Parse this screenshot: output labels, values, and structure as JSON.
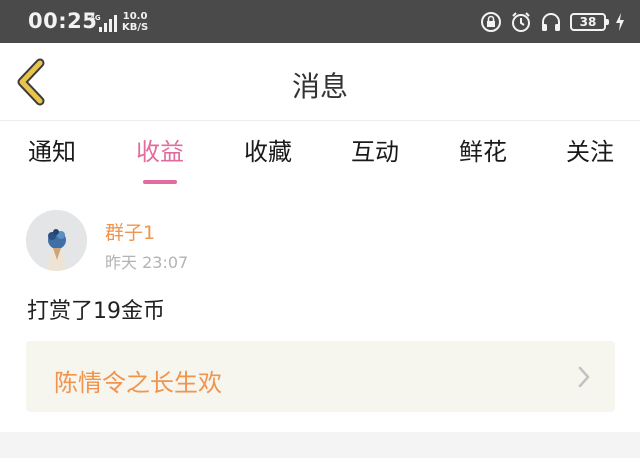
{
  "status_bar": {
    "time": "00:25",
    "network_type": "4G",
    "speed_value": "10.0",
    "speed_unit": "KB/S",
    "battery": "38",
    "icons": [
      "lock-icon",
      "alarm-icon",
      "headphones-icon",
      "battery-icon",
      "charging-icon"
    ]
  },
  "header": {
    "title": "消息",
    "back_icon": "back-chevron-icon"
  },
  "tabs": [
    {
      "label": "通知",
      "active": false
    },
    {
      "label": "收益",
      "active": true
    },
    {
      "label": "收藏",
      "active": false
    },
    {
      "label": "互动",
      "active": false
    },
    {
      "label": "鲜花",
      "active": false
    },
    {
      "label": "关注",
      "active": false
    }
  ],
  "message": {
    "sender": "群子1",
    "time": "昨天 23:07",
    "text": "打赏了19金币",
    "link_title": "陈情令之长生欢",
    "link_icon": "chevron-right-icon"
  },
  "colors": {
    "accent_pink": "#e26c9d",
    "accent_orange": "#f0944e",
    "status_bar_bg": "#4a4a4a",
    "card_bg": "#f6f5ee",
    "back_icon": "#e8c54a"
  }
}
